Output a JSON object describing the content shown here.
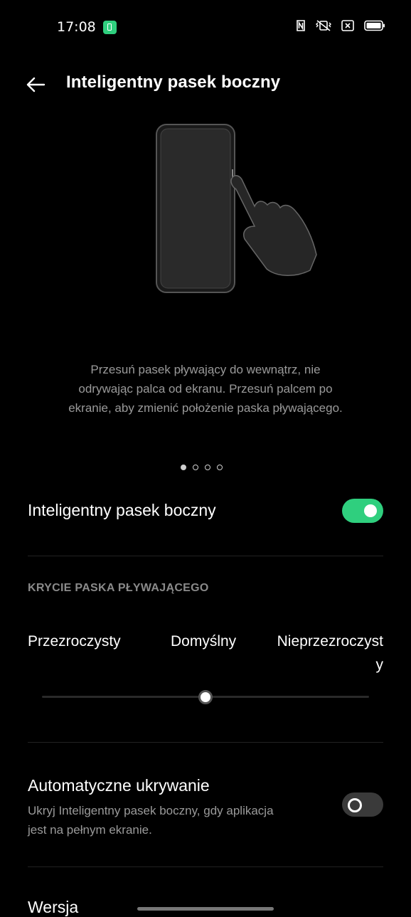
{
  "status_bar": {
    "time": "17:08",
    "icons": [
      "app-notification-icon",
      "nfc-icon",
      "vibrate-icon",
      "sim-off-icon",
      "battery-icon"
    ]
  },
  "header": {
    "title": "Inteligentny pasek boczny",
    "back_icon": "back-arrow-icon"
  },
  "illustration": {
    "icon": "phone-swipe-illustration"
  },
  "description": {
    "lines": [
      "Przesuń pasek pływający do wewnątrz, nie",
      "odrywając palca od ekranu. Przesuń palcem po",
      "ekranie, aby zmienić położenie paska pływającego."
    ]
  },
  "pager": {
    "count": 4,
    "active_index": 0
  },
  "settings": {
    "smart_sidebar": {
      "label": "Inteligentny pasek boczny",
      "enabled": true
    },
    "opacity": {
      "section_title": "KRYCIE PASKA PŁYWAJĄCEGO",
      "labels": [
        "Przezroczysty",
        "Domyślny",
        "Nieprzezroczyst\ny"
      ],
      "value_fraction": 0.5
    },
    "auto_hide": {
      "label": "Automatyczne ukrywanie",
      "description_lines": [
        "Ukryj Inteligentny pasek boczny, gdy aplikacja",
        "jest na pełnym ekranie."
      ],
      "enabled": false
    },
    "version": {
      "label": "Wersja"
    }
  },
  "colors": {
    "accent": "#2fcf7e",
    "background": "#000000",
    "secondary_text": "#9a9a9a"
  }
}
